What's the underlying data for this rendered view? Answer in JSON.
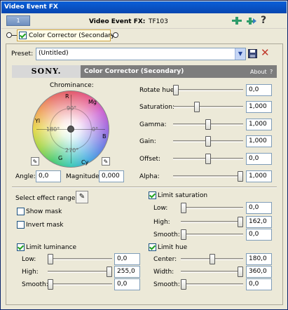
{
  "window": {
    "title": "Video Event FX"
  },
  "fx_header": {
    "tab_number": "1",
    "label": "Video Event FX:",
    "event_name": "TF103"
  },
  "chain": {
    "plugin_label": "Color Corrector (Secondary)"
  },
  "preset": {
    "label": "Preset:",
    "value": "(Untitled)"
  },
  "sony_bar": {
    "logo": "SONY.",
    "title": "Color Corrector (Secondary)",
    "about": "About",
    "help": "?"
  },
  "wheel": {
    "title": "Chrominance:",
    "labels": {
      "r": "R",
      "mg": "Mg",
      "b": "B",
      "cy": "Cy",
      "g": "G",
      "yl": "Yl"
    },
    "degrees": {
      "d90": "90°",
      "d180": "180°",
      "d0": "0°",
      "d270": "270°"
    },
    "angle_label": "Angle:",
    "angle_value": "0,0",
    "magnitude_label": "Magnitude:",
    "magnitude_value": "0,000"
  },
  "params": [
    {
      "label": "Rotate hue:",
      "value": "0,0",
      "level": 0.0
    },
    {
      "label": "Saturation:",
      "value": "1,000",
      "level": 0.33
    },
    {
      "label": "Gamma:",
      "value": "1,000",
      "level": 0.5
    },
    {
      "label": "Gain:",
      "value": "1,000",
      "level": 0.5
    },
    {
      "label": "Offset:",
      "value": "0,0",
      "level": 0.5
    },
    {
      "label": "Alpha:",
      "value": "1,000",
      "level": 1.0
    }
  ],
  "effect_range": {
    "label": "Select effect range:",
    "show_mask": "Show mask",
    "invert_mask": "Invert mask"
  },
  "limit_luminance": {
    "label": "Limit luminance",
    "checked": true,
    "rows": [
      {
        "label": "Low:",
        "value": "0,0",
        "level": 0.0
      },
      {
        "label": "High:",
        "value": "255,0",
        "level": 1.0
      },
      {
        "label": "Smooth:",
        "value": "0,0",
        "level": 0.0
      }
    ]
  },
  "limit_saturation": {
    "label": "Limit saturation",
    "checked": true,
    "rows": [
      {
        "label": "Low:",
        "value": "0,0",
        "level": 0.0
      },
      {
        "label": "High:",
        "value": "162,0",
        "level": 1.0
      },
      {
        "label": "Smooth:",
        "value": "0,0",
        "level": 0.0
      }
    ]
  },
  "limit_hue": {
    "label": "Limit hue",
    "checked": true,
    "rows": [
      {
        "label": "Center:",
        "value": "180,0",
        "level": 0.5
      },
      {
        "label": "Width:",
        "value": "360,0",
        "level": 1.0
      },
      {
        "label": "Smooth:",
        "value": "0,0",
        "level": 0.0
      }
    ]
  },
  "colors": {
    "title_bar": "#0a5fd8",
    "sony_bar": "#7d7d7d",
    "delete_x": "#c0392b",
    "chain_green": "#2e9c6a"
  }
}
